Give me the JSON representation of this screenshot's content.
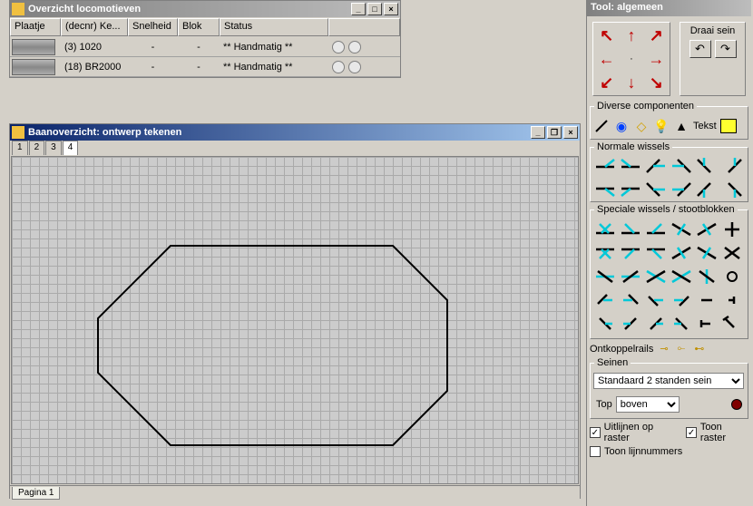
{
  "loco_window": {
    "title": "Overzicht locomotieven",
    "columns": [
      "Plaatje",
      "(decnr) Ke...",
      "Snelheid",
      "Blok",
      "Status"
    ],
    "rows": [
      {
        "decnr": "(3) 1020",
        "snelheid": "-",
        "blok": "-",
        "status": "** Handmatig **"
      },
      {
        "decnr": "(18) BR2000",
        "snelheid": "-",
        "blok": "-",
        "status": "** Handmatig **"
      }
    ]
  },
  "plan_window": {
    "title": "Baanoverzicht: ontwerp tekenen",
    "tabs": [
      "1",
      "2",
      "3",
      "4"
    ],
    "active_tab": "4",
    "page_tab": "Pagina 1"
  },
  "tool_panel": {
    "title": "Tool: algemeen",
    "draai_label": "Draai sein",
    "draai_left": "↶",
    "draai_right": "↷",
    "diverse_label": "Diverse componenten",
    "diverse_text_btn": "Tekst",
    "normale_label": "Normale wissels",
    "speciale_label": "Speciale wissels / stootblokken",
    "ontkoppel_label": "Ontkoppelrails",
    "seinen_label": "Seinen",
    "seinen_value": "Standaard 2 standen sein",
    "top_label": "Top",
    "top_value": "boven",
    "check_uitlijnen": "Uitlijnen op raster",
    "check_toonraster": "Toon raster",
    "check_lijnnrs": "Toon lijnnummers",
    "uitlijnen_checked": true,
    "toonraster_checked": true,
    "lijnnrs_checked": false,
    "arrows": [
      "↖",
      "↑",
      "↗",
      "←",
      "·",
      "→",
      "↙",
      "↓",
      "↘"
    ]
  },
  "winbtns": {
    "min": "_",
    "max": "□",
    "restore": "❐",
    "close": "×"
  }
}
